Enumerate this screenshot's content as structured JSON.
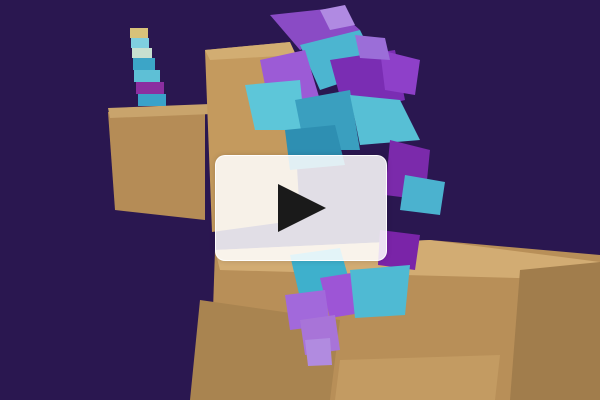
{
  "video": {
    "state": "paused",
    "background_color": "#2a1750",
    "controls": {
      "play_icon": "play-icon",
      "play_icon_color": "#1a1a1a"
    }
  },
  "palette": {
    "tan": "#c49a5e",
    "cyan": "#4fb7cf",
    "violet": "#8b3fc1",
    "lilac": "#a874d8",
    "magenta": "#7c2aa8"
  }
}
